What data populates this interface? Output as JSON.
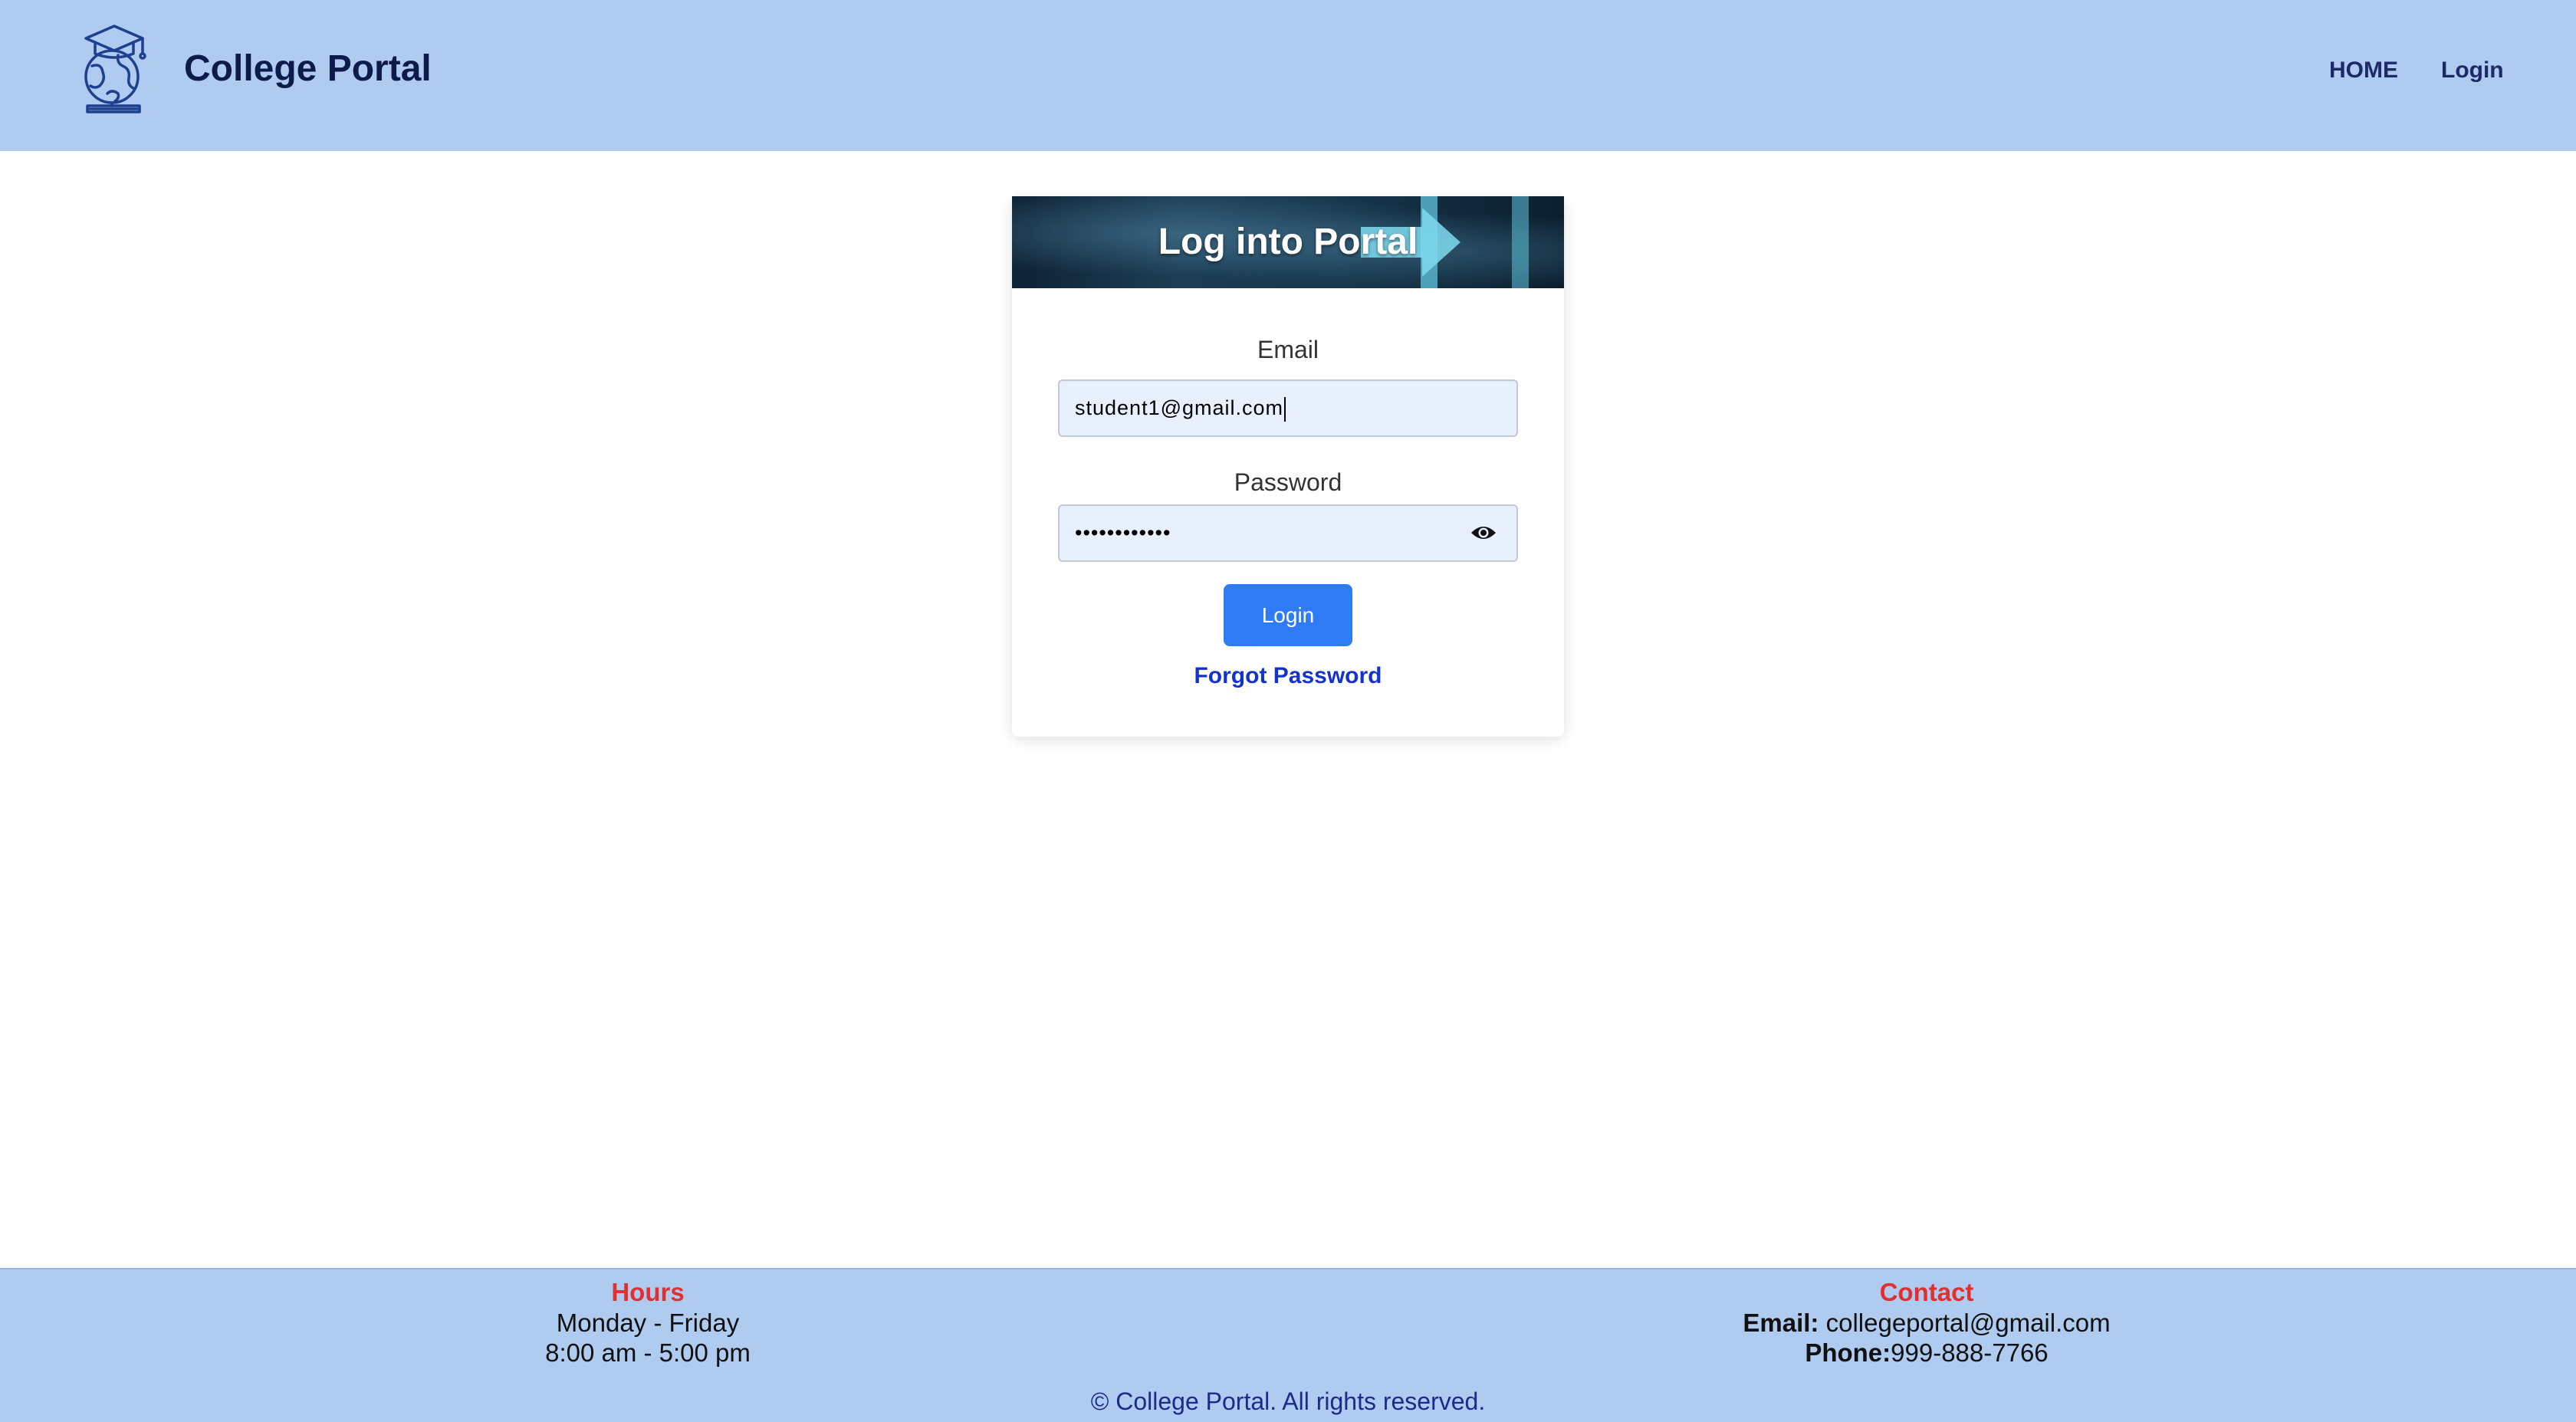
{
  "header": {
    "brand": "College Portal",
    "logo_icon": "graduate-globe-icon",
    "nav": [
      {
        "label": "HOME"
      },
      {
        "label": "Login"
      }
    ]
  },
  "login_card": {
    "banner_title": "Log into Portal",
    "email_label": "Email",
    "email_value": "student1@gmail.com",
    "password_label": "Password",
    "password_value": "••••••••••••",
    "show_password_icon": "eye-icon",
    "login_button": "Login",
    "forgot_link": "Forgot Password"
  },
  "footer": {
    "hours": {
      "heading": "Hours",
      "days": "Monday - Friday",
      "time": "8:00 am - 5:00 pm"
    },
    "contact": {
      "heading": "Contact",
      "email_label": "Email:",
      "email_value": "collegeportal@gmail.com",
      "phone_label": "Phone:",
      "phone_value": "999-888-7766"
    },
    "copyright": "© College Portal. All rights reserved."
  },
  "colors": {
    "header_bg": "#afcbef",
    "button": "#2f7bf5",
    "link": "#1433cc",
    "footer_heading": "#e03030"
  }
}
